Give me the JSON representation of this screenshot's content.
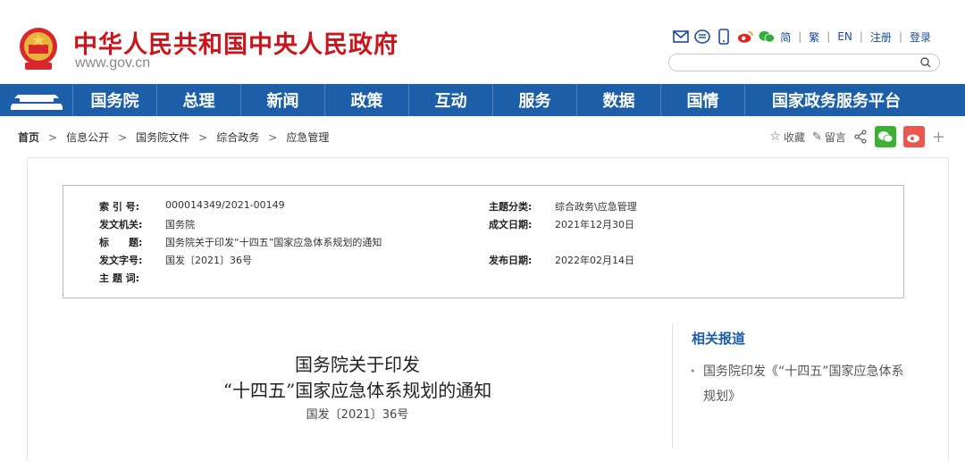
{
  "header": {
    "site_title": "中华人民共和国中央人民政府",
    "site_url": "www.gov.cn",
    "top_links": [
      "简",
      "繁",
      "EN",
      "注册",
      "登录"
    ],
    "icons": [
      "mail-icon",
      "message-icon",
      "mobile-icon",
      "weibo-icon",
      "wechat-icon"
    ],
    "search_placeholder": ""
  },
  "nav": {
    "items": [
      "国务院",
      "总理",
      "新闻",
      "政策",
      "互动",
      "服务",
      "数据",
      "国情",
      "国家政务服务平台"
    ]
  },
  "breadcrumb": [
    "首页",
    "信息公开",
    "国务院文件",
    "综合政务",
    "应急管理"
  ],
  "tools": {
    "favorite": "收藏",
    "comment": "留言",
    "plus": "+"
  },
  "meta": {
    "index_label": "索 引 号:",
    "index_value": "000014349/2021-00149",
    "subject_label": "主题分类:",
    "subject_value": "综合政务\\应急管理",
    "issuer_label": "发文机关:",
    "issuer_value": "国务院",
    "written_label": "成文日期:",
    "written_value": "2021年12月30日",
    "title_label": "标　　题:",
    "title_value": "国务院关于印发“十四五”国家应急体系规划的通知",
    "doc_label": "发文字号:",
    "doc_value": "国发〔2021〕36号",
    "published_label": "发布日期:",
    "published_value": "2022年02月14日",
    "keywords_label": "主 题 词:",
    "keywords_value": ""
  },
  "article": {
    "title_line1": "国务院关于印发",
    "title_line2": "“十四五”国家应急体系规划的通知",
    "doc_number": "国发〔2021〕36号"
  },
  "related": {
    "heading": "相关报道",
    "items": [
      "国务院印发《“十四五”国家应急体系规划》"
    ]
  },
  "colors": {
    "brand_red": "#c8161d",
    "nav_blue": "#1c5fa8",
    "link_blue": "#1b4a9c"
  }
}
